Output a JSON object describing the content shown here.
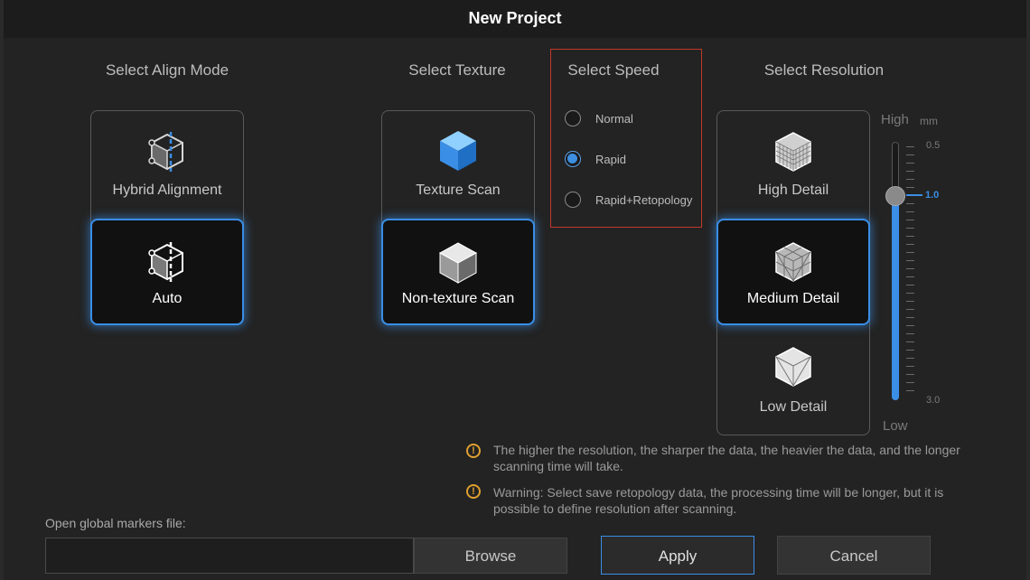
{
  "dialog": {
    "title": "New Project"
  },
  "align_mode": {
    "title": "Select Align Mode",
    "options": [
      {
        "label": "Hybrid Alignment",
        "selected": false,
        "icon": "hybrid-alignment-icon"
      },
      {
        "label": "Auto",
        "selected": true,
        "icon": "auto-alignment-icon"
      }
    ]
  },
  "texture": {
    "title": "Select Texture",
    "options": [
      {
        "label": "Texture Scan",
        "selected": false,
        "icon": "texture-cube-icon"
      },
      {
        "label": "Non-texture Scan",
        "selected": true,
        "icon": "non-texture-cube-icon"
      }
    ]
  },
  "speed": {
    "title": "Select Speed",
    "options": [
      {
        "label": "Normal",
        "selected": false
      },
      {
        "label": "Rapid",
        "selected": true
      },
      {
        "label": "Rapid+Retopology",
        "selected": false
      }
    ]
  },
  "resolution": {
    "title": "Select Resolution",
    "options": [
      {
        "label": "High Detail",
        "selected": false,
        "icon": "high-detail-mesh-icon"
      },
      {
        "label": "Medium Detail",
        "selected": true,
        "icon": "medium-detail-mesh-icon"
      },
      {
        "label": "Low Detail",
        "selected": false,
        "icon": "low-detail-mesh-icon"
      }
    ],
    "slider": {
      "high_label": "High",
      "low_label": "Low",
      "unit": "mm",
      "min_label": "0.5",
      "max_label": "3.0",
      "current_value": "1.0",
      "value": 1.0,
      "min": 0.5,
      "max": 3.0
    }
  },
  "warnings": [
    "The higher the resolution, the sharper the data, the heavier the data, and the longer scanning time will take.",
    "Warning: Select save retopology data, the processing time will be longer, but it is possible to define resolution after scanning."
  ],
  "markers": {
    "label": "Open global markers file:",
    "value": "",
    "browse_label": "Browse"
  },
  "footer": {
    "apply_label": "Apply",
    "cancel_label": "Cancel"
  },
  "colors": {
    "accent": "#3a8ee6",
    "warning": "#e0a030",
    "highlight_box": "#c0392b"
  }
}
